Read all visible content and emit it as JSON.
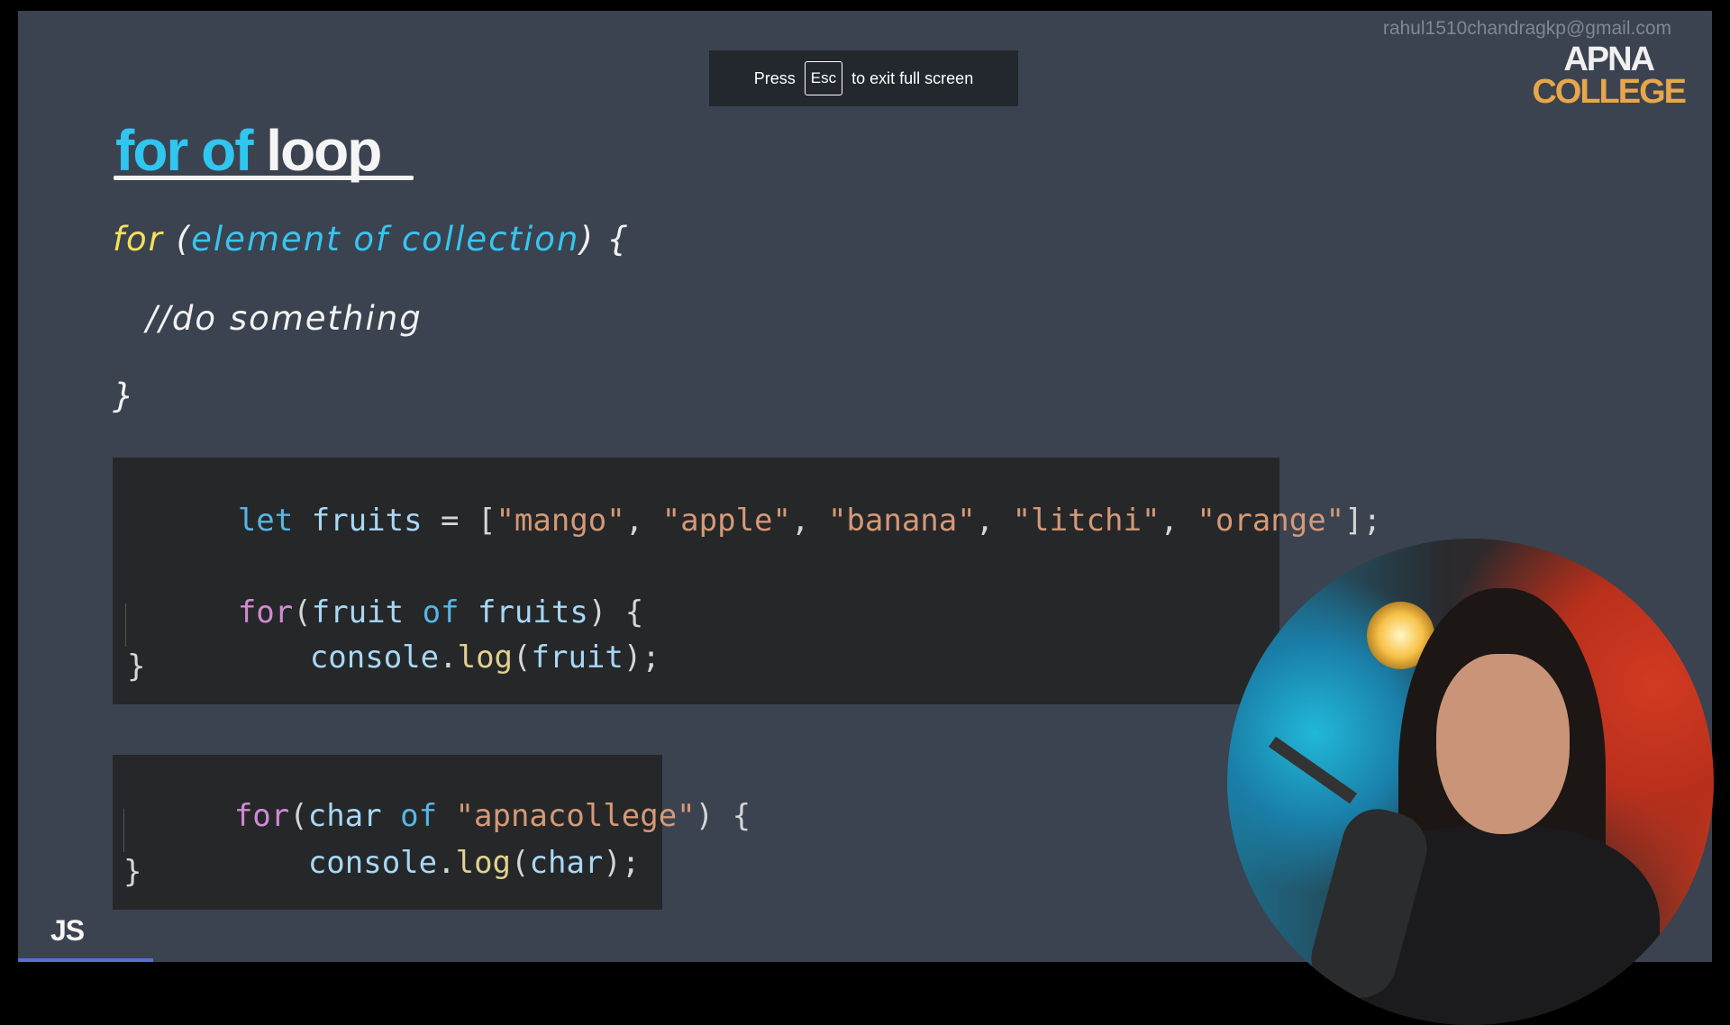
{
  "watermark": {
    "email": "rahul1510chandragkp@gmail.com"
  },
  "logo": {
    "line1": "APNA",
    "line2": "COLLEGE"
  },
  "fullscreen_banner": {
    "before": "Press",
    "key": "Esc",
    "after": "to exit full screen"
  },
  "slide": {
    "title_keyword": "for of",
    "title_rest": "loop",
    "syntax": {
      "line1_for": "for",
      "line1_open": "(",
      "line1_params": "element of collection",
      "line1_close": ") {",
      "line2": "//do something",
      "line3": "}"
    },
    "code1": {
      "l1": [
        "let",
        " fruits ",
        "= [",
        "\"mango\"",
        ", ",
        "\"apple\"",
        ", ",
        "\"banana\"",
        ", ",
        "\"litchi\"",
        ", ",
        "\"orange\"",
        "];"
      ],
      "l3": [
        "for",
        "(",
        "fruit ",
        "of",
        " fruits",
        ") {"
      ],
      "l4": [
        "console",
        ".",
        "log",
        "(",
        "fruit",
        ");"
      ],
      "l5": "}"
    },
    "code2": {
      "l1": [
        "for",
        "(",
        "char ",
        "of",
        " ",
        "\"apnacollege\"",
        ") {"
      ],
      "l2": [
        "console",
        ".",
        "log",
        "(",
        "char",
        ");"
      ],
      "l3": "}"
    },
    "badge": "JS"
  },
  "video": {
    "progress_fraction": 0.08
  }
}
